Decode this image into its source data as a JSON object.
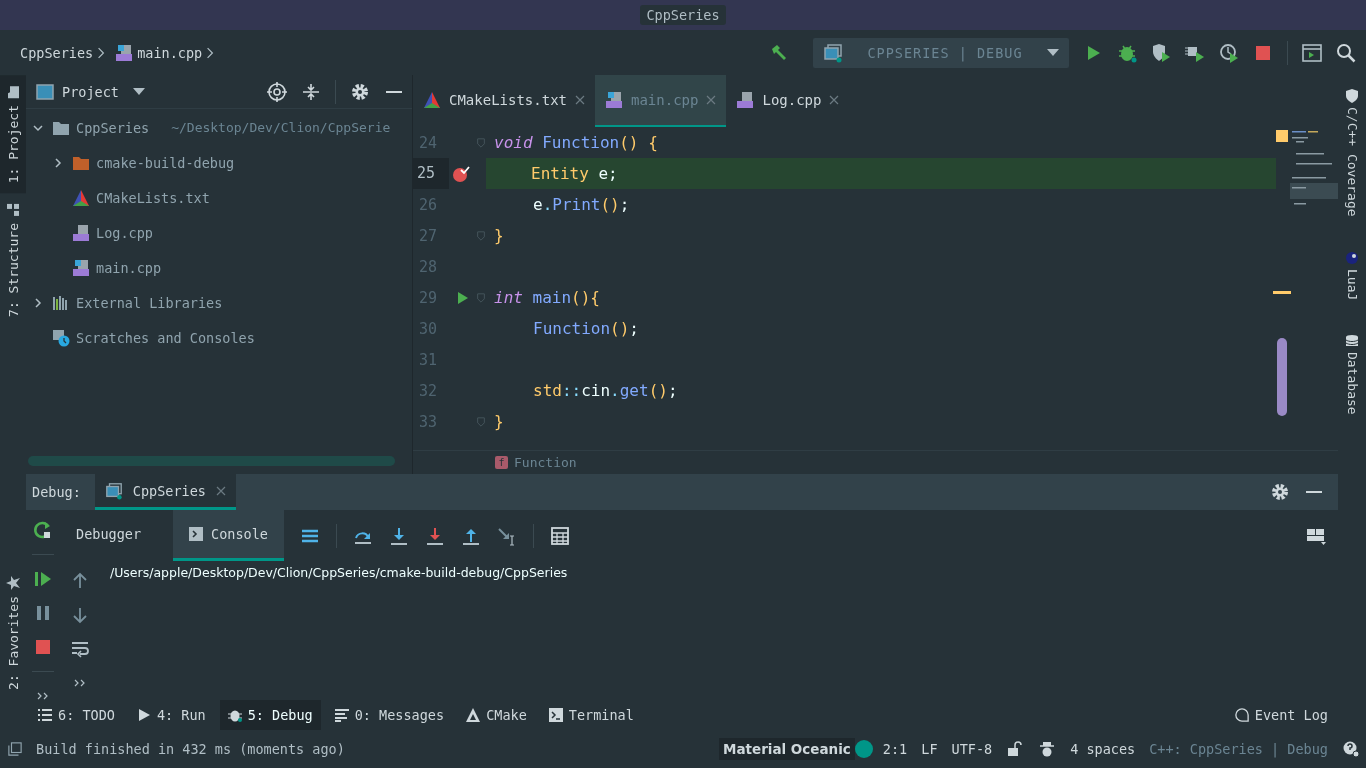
{
  "window": {
    "title": "CppSeries"
  },
  "breadcrumbs": [
    {
      "label": "CppSeries",
      "kind": "project"
    },
    {
      "label": "main.cpp",
      "kind": "file"
    }
  ],
  "run_configuration": {
    "label": "CPPSERIES | DEBUG"
  },
  "left_strip": [
    {
      "label": "1: Project",
      "kind": "folder",
      "selected": true
    },
    {
      "label": "7: Structure",
      "kind": "structure",
      "selected": false
    }
  ],
  "left_strip_bottom": [
    {
      "label": "2: Favorites",
      "kind": "star",
      "selected": false
    }
  ],
  "right_strip": [
    {
      "label": "C/C++ Coverage",
      "kind": "shield"
    },
    {
      "label": "LuaJ",
      "kind": "lua"
    },
    {
      "label": "Database",
      "kind": "database"
    }
  ],
  "project_panel": {
    "title": "Project"
  },
  "tree": [
    {
      "label": "CppSeries",
      "path": "~/Desktop/Dev/Clion/CppSerie",
      "kind": "folder",
      "expanded": true,
      "children": [
        {
          "label": "cmake-build-debug",
          "kind": "build-folder",
          "expanded": false
        },
        {
          "label": "CMakeLists.txt",
          "kind": "cmake"
        },
        {
          "label": "Log.cpp",
          "kind": "cpp"
        },
        {
          "label": "main.cpp",
          "kind": "main-cpp"
        }
      ]
    },
    {
      "label": "External Libraries",
      "kind": "libraries",
      "expanded": false
    },
    {
      "label": "Scratches and Consoles",
      "kind": "scratches"
    }
  ],
  "editor_tabs": [
    {
      "label": "CMakeLists.txt",
      "kind": "cmake",
      "selected": false
    },
    {
      "label": "main.cpp",
      "kind": "main-cpp",
      "selected": true
    },
    {
      "label": "Log.cpp",
      "kind": "cpp",
      "selected": false
    }
  ],
  "code_lines": [
    {
      "number": "24",
      "fold": true,
      "breakpoint": false,
      "run_marker": false,
      "highlighted": false,
      "indented": false,
      "tokens": [
        {
          "text": "void ",
          "kind": "keyword"
        },
        {
          "text": "Function",
          "kind": "function"
        },
        {
          "text": "() {",
          "kind": "paren"
        }
      ]
    },
    {
      "number": "25",
      "fold": false,
      "breakpoint": true,
      "run_marker": false,
      "highlighted": true,
      "indented": true,
      "tokens": [
        {
          "text": "Entity",
          "kind": "type"
        },
        {
          "text": " e",
          "kind": "plain"
        },
        {
          "text": ";",
          "kind": "punct"
        }
      ]
    },
    {
      "number": "26",
      "fold": false,
      "breakpoint": false,
      "run_marker": false,
      "highlighted": false,
      "indented": true,
      "tokens": [
        {
          "text": "e",
          "kind": "plain"
        },
        {
          "text": ".",
          "kind": "dot"
        },
        {
          "text": "Print",
          "kind": "function"
        },
        {
          "text": "()",
          "kind": "paren"
        },
        {
          "text": ";",
          "kind": "punct"
        }
      ]
    },
    {
      "number": "27",
      "fold": true,
      "breakpoint": false,
      "run_marker": false,
      "highlighted": false,
      "indented": false,
      "tokens": [
        {
          "text": "}",
          "kind": "paren"
        }
      ]
    },
    {
      "number": "28",
      "fold": false,
      "breakpoint": false,
      "run_marker": false,
      "highlighted": false
    },
    {
      "number": "29",
      "fold": true,
      "breakpoint": false,
      "run_marker": true,
      "highlighted": false,
      "indented": false,
      "tokens": [
        {
          "text": "int ",
          "kind": "keyword"
        },
        {
          "text": "main",
          "kind": "function"
        },
        {
          "text": "(){",
          "kind": "paren"
        }
      ]
    },
    {
      "number": "30",
      "fold": false,
      "breakpoint": false,
      "run_marker": false,
      "highlighted": false,
      "indented": true,
      "tokens": [
        {
          "text": "Function",
          "kind": "function"
        },
        {
          "text": "()",
          "kind": "paren"
        },
        {
          "text": ";",
          "kind": "punct"
        }
      ]
    },
    {
      "number": "31",
      "fold": false,
      "breakpoint": false,
      "run_marker": false,
      "highlighted": false
    },
    {
      "number": "32",
      "fold": false,
      "breakpoint": false,
      "run_marker": false,
      "highlighted": false,
      "indented": true,
      "tokens": [
        {
          "text": "std",
          "kind": "type"
        },
        {
          "text": "::",
          "kind": "dot"
        },
        {
          "text": "cin",
          "kind": "plain"
        },
        {
          "text": ".",
          "kind": "dot"
        },
        {
          "text": "get",
          "kind": "function"
        },
        {
          "text": "()",
          "kind": "paren"
        },
        {
          "text": ";",
          "kind": "punct"
        }
      ]
    },
    {
      "number": "33",
      "fold": true,
      "breakpoint": false,
      "run_marker": false,
      "highlighted": false,
      "indented": false,
      "tokens": [
        {
          "text": "}",
          "kind": "paren"
        }
      ]
    }
  ],
  "editor_breadcrumb": {
    "label": "Function",
    "icon_letter": "f"
  },
  "debug": {
    "label": "Debug:",
    "session_tab": {
      "label": "CppSeries",
      "selected": true
    },
    "subtabs": [
      {
        "label": "Debugger",
        "kind": "plain",
        "selected": false
      },
      {
        "label": "Console",
        "kind": "console",
        "selected": true
      }
    ],
    "console_output": "/Users/apple/Desktop/Dev/Clion/CppSeries/cmake-build-debug/CppSeries"
  },
  "tool_tabs": [
    {
      "label": "6: TODO",
      "kind": "list",
      "selected": false
    },
    {
      "label": "4: Run",
      "kind": "run",
      "selected": false
    },
    {
      "label": "5: Debug",
      "kind": "bug",
      "selected": true
    },
    {
      "label": "0: Messages",
      "kind": "messages",
      "selected": false
    },
    {
      "label": "CMake",
      "kind": "cmake",
      "selected": false
    },
    {
      "label": "Terminal",
      "kind": "terminal",
      "selected": false
    }
  ],
  "event_log": {
    "label": "Event Log"
  },
  "status_bar": {
    "message": "Build finished in 432 ms (moments ago)",
    "theme": {
      "label": "Material Oceanic",
      "color": "#009688"
    },
    "position": "2:1",
    "line_separator": "LF",
    "encoding": "UTF-8",
    "indent": "4 spaces",
    "context": "C++: CppSeries | Debug"
  }
}
